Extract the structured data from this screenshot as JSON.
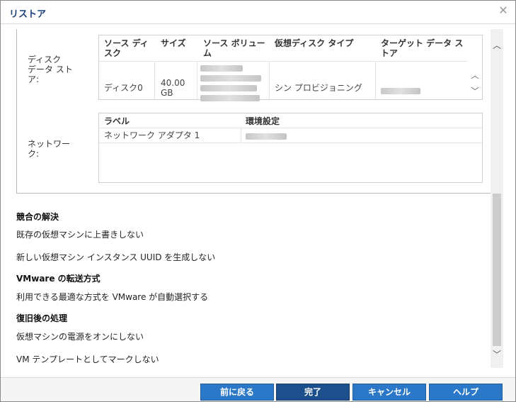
{
  "dialog": {
    "title": "リストア",
    "close_glyph": "✕"
  },
  "datastore": {
    "label": "ディスク\nデータ スト\nア:",
    "headers": [
      "ソース ディ\nスク",
      "サイズ",
      "ソース ボリュー\nム",
      "仮想ディスク タイプ",
      "ターゲット データ ス\nトア"
    ],
    "rows": [
      {
        "source_disk": "ディスク0",
        "size": "40.00\nGB",
        "disk_type": "シン プロビジョニング"
      }
    ]
  },
  "network": {
    "label": "ネットワー\nク:",
    "headers": [
      "ラベル",
      "環境設定"
    ],
    "rows": [
      {
        "label": "ネットワーク アダプタ 1"
      }
    ]
  },
  "sections": {
    "conflict_title": "競合の解決",
    "conflict_item1": "既存の仮想マシンに上書きしない",
    "conflict_item2": "新しい仮想マシン インスタンス UUID を生成しない",
    "transport_title": "VMware の転送方式",
    "transport_item1": "利用できる最適な方式を VMware が自動選択する",
    "post_title": "復旧後の処理",
    "post_item1": "仮想マシンの電源をオンにしない",
    "post_item2": "VM テンプレートとしてマークしない"
  },
  "buttons": {
    "back": "前に戻る",
    "finish": "完了",
    "cancel": "キャンセル",
    "help": "ヘルプ"
  },
  "colors": {
    "button": "#2a78c7",
    "button_primary": "#1d4f8c",
    "title": "#1a3e7a"
  }
}
